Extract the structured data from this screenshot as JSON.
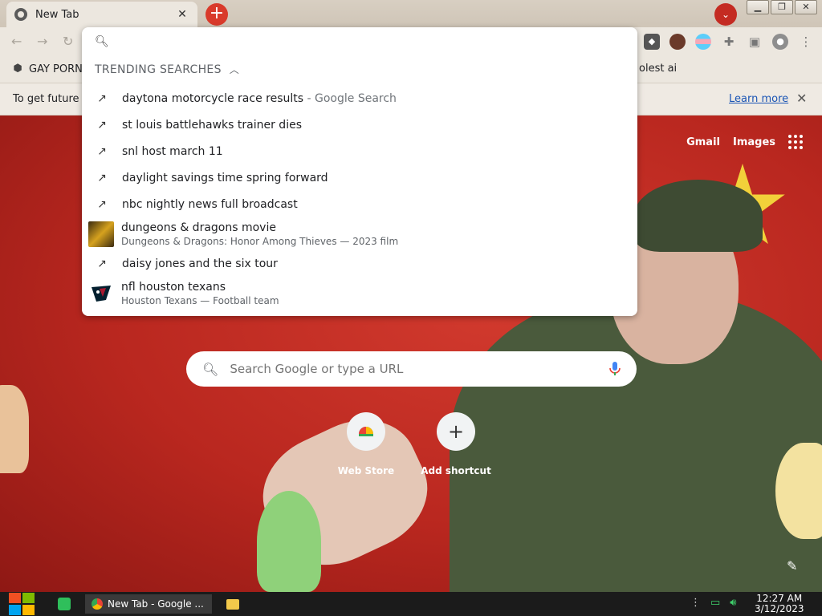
{
  "tab": {
    "title": "New Tab",
    "close": "✕"
  },
  "tabstrip": {
    "new_tab": "+",
    "tab_search": "⌄"
  },
  "window_controls": {
    "minimize": "▁",
    "maximize": "❐",
    "close": "✕"
  },
  "bookmarks": [
    {
      "label": "GAY PORN",
      "icon": "shield-icon"
    },
    {
      "label": "olest ai",
      "icon": ""
    }
  ],
  "infobar": {
    "text": "To get future",
    "link": "Learn more",
    "close": "✕"
  },
  "omnibox": {
    "value": "",
    "section_header": "TRENDING SEARCHES",
    "suggestions": [
      {
        "text": "daytona motorcycle race results",
        "suffix": " - Google Search",
        "icon": "trending-icon"
      },
      {
        "text": "st louis battlehawks trainer dies",
        "icon": "trending-icon"
      },
      {
        "text": "snl host march 11",
        "icon": "trending-icon"
      },
      {
        "text": "daylight savings time spring forward",
        "icon": "trending-icon"
      },
      {
        "text": "nbc nightly news full broadcast",
        "icon": "trending-icon"
      },
      {
        "text": "dungeons & dragons movie",
        "subtitle": "Dungeons & Dragons: Honor Among Thieves — 2023 film",
        "icon": "movie-thumbnail"
      },
      {
        "text": "daisy jones and the six tour",
        "icon": "trending-icon"
      },
      {
        "text": "nfl houston texans",
        "subtitle": "Houston Texans — Football team",
        "icon": "texans-logo"
      }
    ]
  },
  "ntp": {
    "gmail": "Gmail",
    "images": "Images",
    "search_placeholder": "Search Google or type a URL",
    "shortcuts": [
      {
        "label": "Web Store",
        "icon": "webstore-icon"
      },
      {
        "label": "Add shortcut",
        "icon": "plus-icon",
        "glyph": "+"
      }
    ]
  },
  "taskbar": {
    "chrome_label": "New Tab - Google ...",
    "time": "12:27 AM",
    "date": "3/12/2023"
  },
  "colors": {
    "accent_red": "#d93a2b",
    "link_blue": "#1a55b5"
  }
}
